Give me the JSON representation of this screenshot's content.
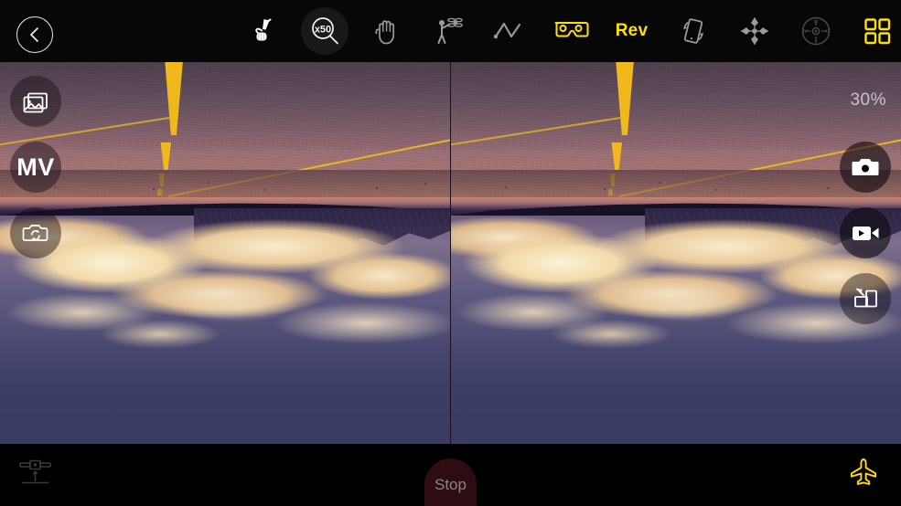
{
  "app": {
    "title": "FPV Drone Camera Controller",
    "accent_yellow": "#ffe000",
    "toolbar_bg": "#070707",
    "stop_bg": "#2e0d12"
  },
  "topbar": {
    "back_button": {
      "name": "back-button",
      "icon": "chevron-left-icon"
    },
    "items": [
      {
        "id": "gesture",
        "icon": "hand-peace-icon",
        "label": "",
        "active": false,
        "highlight": false
      },
      {
        "id": "zoom",
        "icon": "magnifier-icon",
        "label": "x50",
        "active": false,
        "highlight": true
      },
      {
        "id": "palm",
        "icon": "hand-palm-icon",
        "label": "",
        "active": false,
        "highlight": false
      },
      {
        "id": "follow",
        "icon": "person-drone-follow-icon",
        "label": "",
        "active": false,
        "highlight": false
      },
      {
        "id": "waypoint",
        "icon": "waypoint-path-icon",
        "label": "",
        "active": false,
        "highlight": false
      },
      {
        "id": "vr",
        "icon": "vr-goggles-icon",
        "label": "",
        "active": true,
        "highlight": false
      },
      {
        "id": "rev",
        "icon": "text-label",
        "label": "Rev",
        "active": true,
        "highlight": false
      },
      {
        "id": "rotate",
        "icon": "phone-rotate-icon",
        "label": "",
        "active": false,
        "highlight": false
      },
      {
        "id": "target",
        "icon": "crosshair-target-icon",
        "label": "",
        "active": false,
        "highlight": false
      },
      {
        "id": "compass",
        "icon": "compass-icon",
        "label": "",
        "active": false,
        "highlight": false
      },
      {
        "id": "grid",
        "icon": "grid-2x2-icon",
        "label": "",
        "active": true,
        "highlight": false
      }
    ]
  },
  "overlay": {
    "gallery_button": {
      "name": "gallery-button",
      "icon": "image-icon"
    },
    "mv_button": {
      "name": "mv-mode-button",
      "label": "MV"
    },
    "camera_switch_button": {
      "name": "camera-switch-button",
      "icon": "camera-rotate-icon"
    },
    "photo_button": {
      "name": "photo-capture-button",
      "icon": "camera-icon"
    },
    "video_button": {
      "name": "video-record-button",
      "icon": "video-camera-icon"
    },
    "swap_button": {
      "name": "screen-swap-button",
      "icon": "screen-swap-icon"
    },
    "battery": "30%"
  },
  "bottombar": {
    "takeoff_button": {
      "name": "takeoff-landing-button",
      "icon": "drone-takeoff-icon"
    },
    "stop_button": {
      "name": "stop-button",
      "label": "Stop"
    },
    "aircraft_button": {
      "name": "aircraft-status-button",
      "icon": "airplane-icon"
    }
  },
  "feed": {
    "mode": "stereo-vr-split",
    "left_eye": "live-camera-view-left",
    "right_eye": "live-camera-view-right",
    "orientation": "inverted"
  }
}
